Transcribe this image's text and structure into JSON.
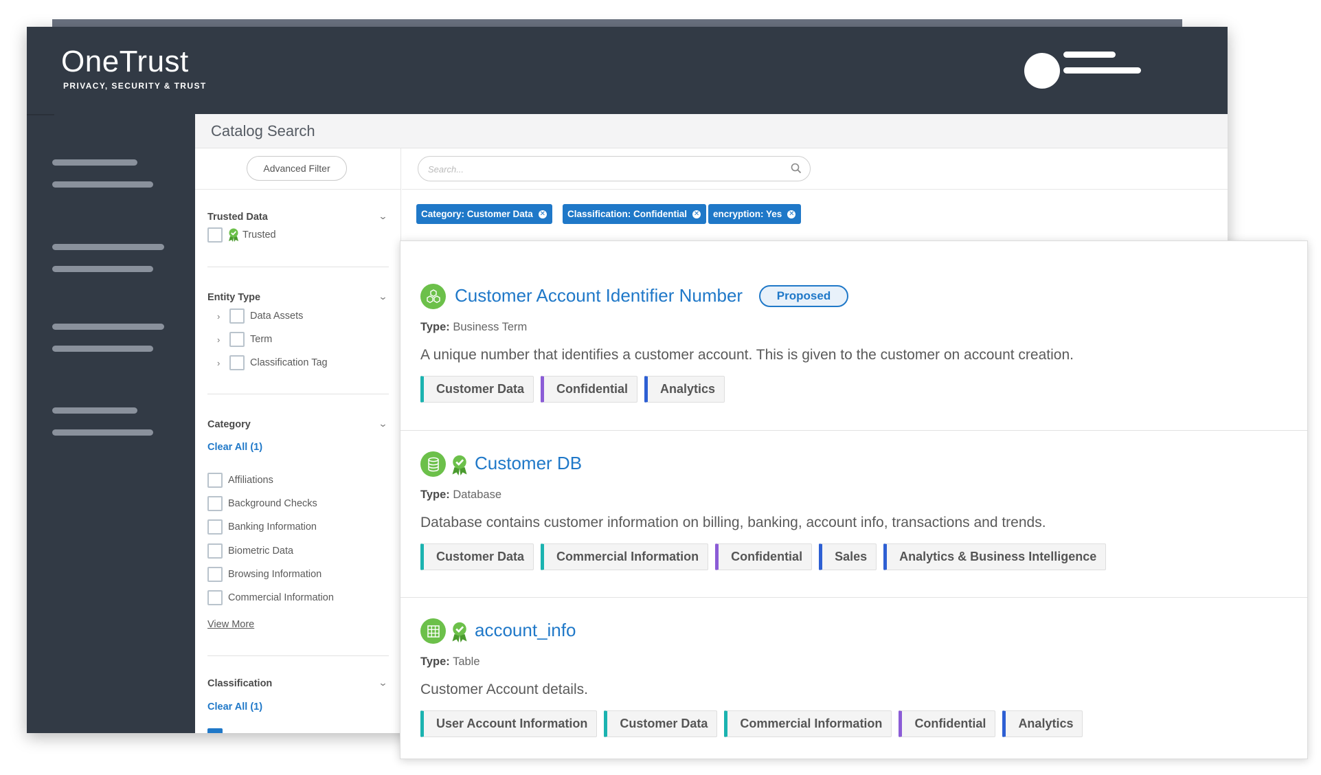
{
  "brand": {
    "name": "OneTrust",
    "tagline": "PRIVACY, SECURITY & TRUST"
  },
  "page": {
    "title": "Catalog Search"
  },
  "filters": {
    "advanced_filter_label": "Advanced Filter",
    "trusted_data": {
      "title": "Trusted Data",
      "options": [
        {
          "label": "Trusted",
          "checked": false
        }
      ]
    },
    "entity_type": {
      "title": "Entity Type",
      "options": [
        {
          "label": "Data Assets",
          "checked": false
        },
        {
          "label": "Term",
          "checked": false
        },
        {
          "label": "Classification Tag",
          "checked": false
        }
      ]
    },
    "category": {
      "title": "Category",
      "clear_label": "Clear All (1)",
      "options": [
        {
          "label": "Affiliations",
          "checked": false
        },
        {
          "label": "Background Checks",
          "checked": false
        },
        {
          "label": "Banking Information",
          "checked": false
        },
        {
          "label": "Biometric Data",
          "checked": false
        },
        {
          "label": "Browsing Information",
          "checked": false
        },
        {
          "label": "Commercial Information",
          "checked": false
        }
      ],
      "view_more_label": "View More"
    },
    "classification": {
      "title": "Classification",
      "clear_label": "Clear All (1)"
    }
  },
  "search": {
    "placeholder": "Search...",
    "value": ""
  },
  "active_filters": [
    {
      "label": "Category: Customer Data"
    },
    {
      "label": "Classification: Confidential"
    },
    {
      "label": "encryption: Yes"
    }
  ],
  "results": [
    {
      "icon": "business-term-icon",
      "title": "Customer Account Identifier Number",
      "trusted": false,
      "status": "Proposed",
      "type_label": "Type:",
      "type": "Business Term",
      "description": "A unique number that identifies a customer account. This is given to the customer on account creation.",
      "tags": [
        {
          "label": "Customer Data",
          "color": "teal"
        },
        {
          "label": "Confidential",
          "color": "purple"
        },
        {
          "label": "Analytics",
          "color": "blue"
        }
      ]
    },
    {
      "icon": "database-icon",
      "title": "Customer DB",
      "trusted": true,
      "type_label": "Type:",
      "type": "Database",
      "description": "Database contains customer information on billing, banking, account info, transactions and trends.",
      "tags": [
        {
          "label": "Customer Data",
          "color": "teal"
        },
        {
          "label": "Commercial Information",
          "color": "teal"
        },
        {
          "label": "Confidential",
          "color": "purple"
        },
        {
          "label": "Sales",
          "color": "blue"
        },
        {
          "label": "Analytics & Business Intelligence",
          "color": "blue"
        }
      ]
    },
    {
      "icon": "table-icon",
      "title": "account_info",
      "trusted": true,
      "type_label": "Type:",
      "type": "Table",
      "description": "Customer Account details.",
      "tags": [
        {
          "label": "User Account Information",
          "color": "teal"
        },
        {
          "label": "Customer Data",
          "color": "teal"
        },
        {
          "label": "Commercial Information",
          "color": "teal"
        },
        {
          "label": "Confidential",
          "color": "purple"
        },
        {
          "label": "Analytics",
          "color": "blue"
        }
      ]
    }
  ],
  "colors": {
    "header_bg": "#323a45",
    "accent_blue": "#1f78c8",
    "icon_green": "#6cc04a",
    "tag_teal": "#1bb3b0",
    "tag_purple": "#8b5cd6",
    "tag_blue": "#2d5fd3"
  }
}
